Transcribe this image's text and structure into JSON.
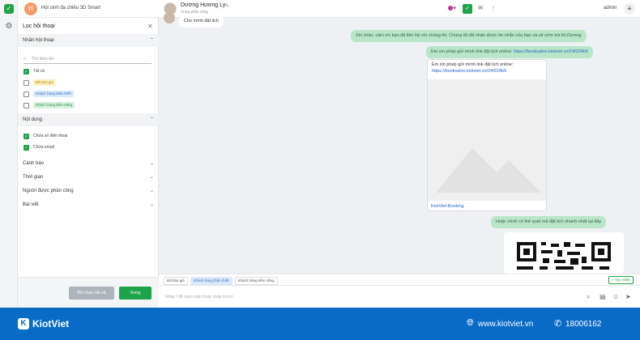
{
  "shop": {
    "avatar": "H",
    "name": "Hội sinh đa chiều 3D Smart"
  },
  "customer": {
    "name": "Dương Hương Ly",
    "status": "Chưa phân công"
  },
  "user": {
    "name": "admin"
  },
  "filter": {
    "title": "Lọc hội thoại",
    "sections": {
      "labels": "Nhãn hội thoại",
      "content": "Nội dung",
      "alert": "Cảnh báo",
      "time": "Thời gian",
      "assignee": "Người được phân công",
      "post": "Bài viết"
    },
    "search_placeholder": "Tìm thẻo tên",
    "labels": [
      {
        "text": "Tất cả",
        "checked": true
      },
      {
        "text": "Đã báo giá",
        "checked": false
      },
      {
        "text": "Khách hàng thân thiết",
        "checked": false
      },
      {
        "text": "Khách hàng tiềm năng",
        "checked": false
      }
    ],
    "content": [
      {
        "text": "Chứa số điện thoại",
        "checked": true
      },
      {
        "text": "Chứa email",
        "checked": true
      }
    ],
    "clear_label": "Bỏ chọn tất cả",
    "done_label": "Xong"
  },
  "messages": {
    "incoming_1": "Cho mình đặt lịch",
    "out_1": "Xin chào, cảm ơn bạn đã liên hệ với chúng tôi. Chúng tôi đã nhận được tin nhắn của bạn và sẽ sớm trả lời.Dương",
    "out_2_text": "Em xin phép gửi mình link đặt lịch online: ",
    "out_2_link": "https://booksalon.kiotviet.vn/24f224b5",
    "card_text": "Em xin phép gửi mình link đặt lịch online:",
    "card_link": "https://booksalon.kiotviet.vn/24f224b5",
    "card_caption": "KiotViet-Booking",
    "out_3": "Hoặc mình có thể quét mã đặt lịch nhanh nhất tại đây"
  },
  "quick_tags": [
    "Đã báo giá",
    "Khách hàng thân thiết",
    "Khách hàng tiềm năng"
  ],
  "new_tag_label": "+ Tạo nhãn",
  "input_placeholder": "Nhập / để chọn mẫu hoặc nhập trả lời",
  "footer": {
    "brand": "KiotViet",
    "site": "www.kiotviet.vn",
    "phone": "18006162"
  },
  "colors": {
    "accent": "#1fa34a",
    "footer": "#0a6bc7",
    "bubble_out": "#b9e6c8"
  }
}
